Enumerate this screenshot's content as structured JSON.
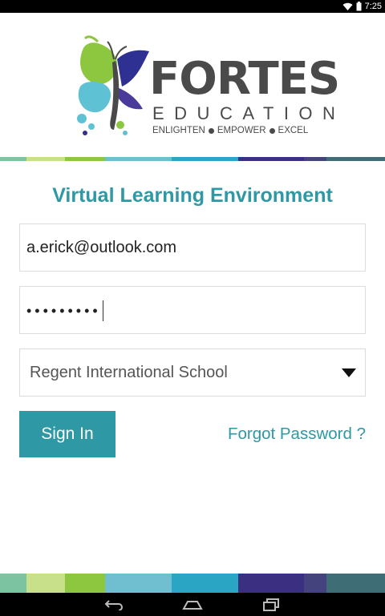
{
  "status_bar": {
    "time": "7:25",
    "icons": [
      "wifi-icon",
      "battery-icon"
    ]
  },
  "logo": {
    "brand": "FORTES",
    "subtitle": "EDUCATION",
    "tagline": [
      "ENLIGHTEN",
      "EMPOWER",
      "EXCEL"
    ],
    "colors": [
      "#8dc63f",
      "#5fc1d4",
      "#2e3192",
      "#4a4a4a"
    ]
  },
  "stripe_colors": [
    "#7cc3a2",
    "#c9e08a",
    "#8dc63f",
    "#6fbfd0",
    "#2aa6c4",
    "#3b2f82",
    "#44437e",
    "#3f6d75",
    "#4e6f79"
  ],
  "form": {
    "title": "Virtual Learning Environment",
    "email_value": "a.erick@outlook.com",
    "password_mask": "•••••••••",
    "school_selected": "Regent International School",
    "signin_label": "Sign In",
    "forgot_label": "Forgot Password ?"
  },
  "nav_bar": {
    "icons": [
      "back-icon",
      "home-icon",
      "recents-icon"
    ]
  },
  "accent_color": "#2e98a5"
}
